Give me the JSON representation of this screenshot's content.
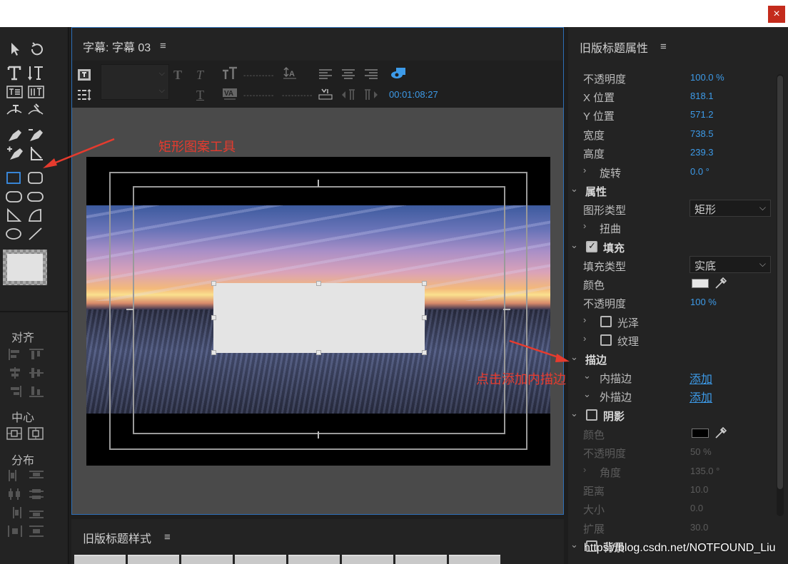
{
  "window": {
    "close_label": "×"
  },
  "tools_panel": {
    "align_label": "对齐",
    "center_label": "中心",
    "distribute_label": "分布"
  },
  "title_panel": {
    "title": "字幕: 字幕 03",
    "menu_icon": "≡",
    "timecode": "00:01:08:27",
    "dashes": "----------"
  },
  "styles_panel": {
    "title": "旧版标题样式",
    "menu_icon": "≡"
  },
  "properties": {
    "title": "旧版标题属性",
    "menu_icon": "≡",
    "rows": {
      "opacity": {
        "label": "不透明度",
        "value": "100.0 %"
      },
      "x_pos": {
        "label": "X 位置",
        "value": "818.1"
      },
      "y_pos": {
        "label": "Y 位置",
        "value": "571.2"
      },
      "width": {
        "label": "宽度",
        "value": "738.5"
      },
      "height": {
        "label": "高度",
        "value": "239.3"
      },
      "rotation": {
        "label": "旋转",
        "value": "0.0 °"
      },
      "attributes": {
        "label": "属性"
      },
      "shape_type": {
        "label": "图形类型",
        "value": "矩形"
      },
      "distort": {
        "label": "扭曲"
      },
      "fill": {
        "label": "填充"
      },
      "fill_type": {
        "label": "填充类型",
        "value": "实底"
      },
      "fill_color": {
        "label": "颜色",
        "swatch": "#e6e6e6"
      },
      "fill_opacity": {
        "label": "不透明度",
        "value": "100 %"
      },
      "sheen": {
        "label": "光泽"
      },
      "texture": {
        "label": "纹理"
      },
      "stroke": {
        "label": "描边"
      },
      "inner_stroke": {
        "label": "内描边",
        "action": "添加"
      },
      "outer_stroke": {
        "label": "外描边",
        "action": "添加"
      },
      "shadow": {
        "label": "阴影"
      },
      "shadow_color": {
        "label": "颜色",
        "swatch": "#000000"
      },
      "shadow_opacity": {
        "label": "不透明度",
        "value": "50 %"
      },
      "shadow_angle": {
        "label": "角度",
        "value": "135.0 °"
      },
      "shadow_distance": {
        "label": "距离",
        "value": "10.0"
      },
      "shadow_size": {
        "label": "大小",
        "value": "0.0"
      },
      "shadow_spread": {
        "label": "扩展",
        "value": "30.0"
      },
      "background": {
        "label": "背景"
      }
    }
  },
  "annotations": {
    "rect_tool": "矩形图案工具",
    "inner_stroke_hint": "点击添加内描边"
  },
  "watermark": "https://blog.csdn.net/NOTFOUND_Liu",
  "colors": {
    "accent": "#3d9be9",
    "annotation": "#e63b2e",
    "panel": "#232323"
  }
}
